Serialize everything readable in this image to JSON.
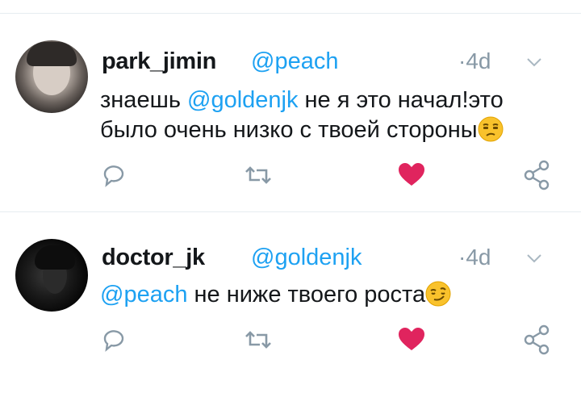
{
  "tweets": [
    {
      "username": "park_jimin",
      "handle": "@peach",
      "time": "4d",
      "text_prefix": "знаешь ",
      "mention": "@goldenjk",
      "text_line1_rest": " не я это начал!это",
      "text_line2": "было очень низко с твоей стороны",
      "emoji": "unamused-face",
      "liked": true
    },
    {
      "username": "doctor_jk",
      "handle": "@goldenjk",
      "time": "4d",
      "mention": "@peach",
      "text_rest": " не ниже твоего роста",
      "emoji": "smirking-face",
      "liked": true
    }
  ],
  "colors": {
    "link": "#1da1f2",
    "muted": "#8899a6",
    "like": "#e0245e",
    "text": "#14171a"
  }
}
